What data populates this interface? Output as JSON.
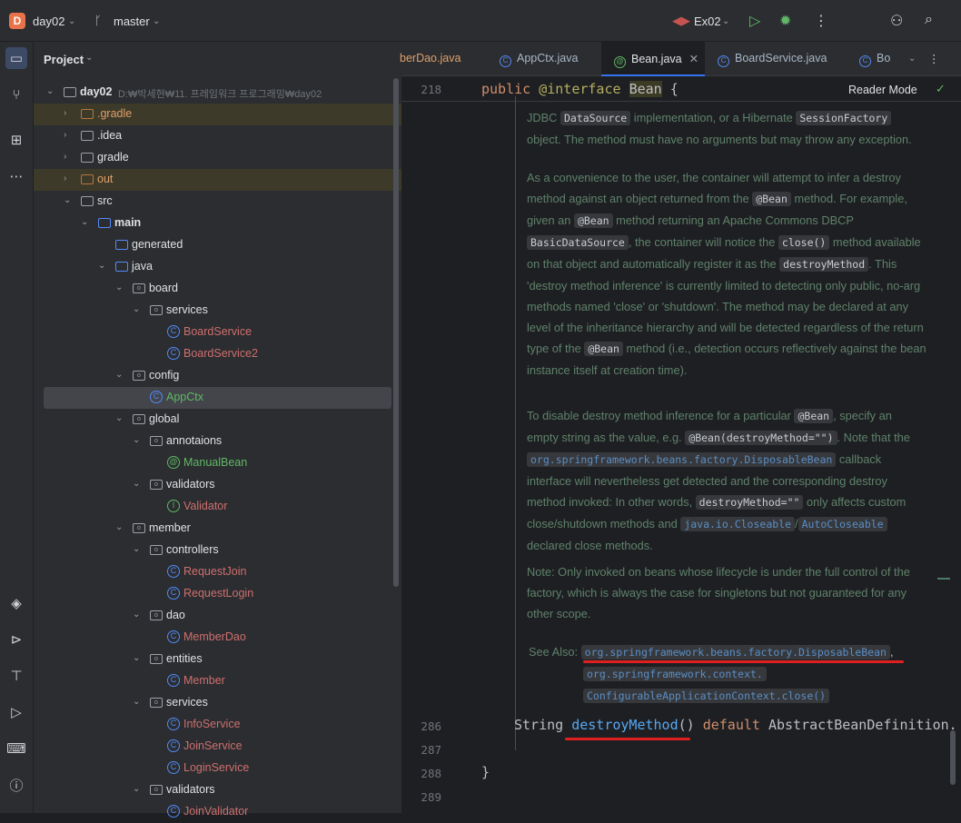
{
  "topbar": {
    "project_badge": "D",
    "project_name": "day02",
    "branch": "master",
    "run_config": "Ex02"
  },
  "project_panel": {
    "title": "Project",
    "root_name": "day02",
    "root_path": "D:₩박세현₩11. 프레임워크 프로그래밍₩day02",
    "items": [
      {
        "label": "src"
      },
      {
        "label": ".gradle"
      },
      {
        "label": ".idea"
      },
      {
        "label": "gradle"
      },
      {
        "label": "out"
      },
      {
        "label": "main"
      },
      {
        "label": "generated"
      },
      {
        "label": "java"
      },
      {
        "label": "board"
      },
      {
        "label": "services"
      },
      {
        "label": "BoardService"
      },
      {
        "label": "BoardService2"
      },
      {
        "label": "config"
      },
      {
        "label": "AppCtx"
      },
      {
        "label": "global"
      },
      {
        "label": "annotaions"
      },
      {
        "label": "ManualBean"
      },
      {
        "label": "validators"
      },
      {
        "label": "Validator"
      },
      {
        "label": "member"
      },
      {
        "label": "controllers"
      },
      {
        "label": "RequestJoin"
      },
      {
        "label": "RequestLogin"
      },
      {
        "label": "dao"
      },
      {
        "label": "MemberDao"
      },
      {
        "label": "entities"
      },
      {
        "label": "Member"
      },
      {
        "label": "services"
      },
      {
        "label": "InfoService"
      },
      {
        "label": "JoinService"
      },
      {
        "label": "LoginService"
      },
      {
        "label": "validators"
      },
      {
        "label": "JoinValidator"
      }
    ]
  },
  "tabs": [
    {
      "label": "berDao.java"
    },
    {
      "label": "AppCtx.java"
    },
    {
      "label": "Bean.java"
    },
    {
      "label": "BoardService.java"
    },
    {
      "label": "Bo"
    }
  ],
  "editor": {
    "reader_mode": "Reader Mode",
    "line_218": "218",
    "line_286": "286",
    "line_287": "287",
    "line_288": "288",
    "line_289": "289",
    "code_218_kw": "public",
    "code_218_ann": "@interface",
    "code_218_name": "Bean",
    "code_218_brace": " {",
    "code_286_type": "String ",
    "code_286_method": "destroyMethod",
    "code_286_parens": "() ",
    "code_286_kw": "default",
    "code_286_rest": " AbstractBeanDefinition.",
    "code_288": "}",
    "doc": {
      "p1_a": "JDBC ",
      "p1_code1": "DataSource",
      "p1_b": " implementation, or a Hibernate ",
      "p1_code2": "SessionFactory",
      "p1_c": "object. The method must have no arguments but may throw any exception.",
      "p2_a": "As a convenience to the user, the container will attempt to infer a destroy method against an object returned from the ",
      "p2_code1": "@Bean",
      "p2_b": " method. For example, given an ",
      "p2_code2": "@Bean",
      "p2_c": " method returning an Apache Commons DBCP ",
      "p2_code3": "BasicDataSource",
      "p2_d": ", the container will notice the ",
      "p2_code4": "close()",
      "p2_e": " method available on that object and automatically register it as the ",
      "p2_code5": "destroyMethod",
      "p2_f": ". This 'destroy method inference' is currently limited to detecting only public, no-arg methods named 'close' or 'shutdown'. The method may be declared at any level of the inheritance hierarchy and will be detected regardless of the return type of the ",
      "p2_code6": "@Bean",
      "p2_g": " method (i.e., detection occurs reflectively against the bean instance itself at creation time).",
      "p3_a": "To disable destroy method inference for a particular ",
      "p3_code1": "@Bean",
      "p3_b": ", specify an empty string as the value, e.g. ",
      "p3_code2": "@Bean(destroyMethod=\"\")",
      "p3_c": ". Note that the ",
      "p3_link1": "org.springframework.beans.factory.DisposableBean",
      "p3_d": " callback interface will nevertheless get detected and the corresponding destroy method invoked: In other words, ",
      "p3_code3": "destroyMethod=\"\"",
      "p3_e": " only affects custom close/shutdown methods and ",
      "p3_link2": "java.io.Closeable",
      "p3_slash": "/",
      "p3_link3": "AutoCloseable",
      "p3_f": " declared close methods.",
      "p4": "Note: Only invoked on beans whose lifecycle is under the full control of the factory, which is always the case for singletons but not guaranteed for any other scope.",
      "see_also": "See Also:",
      "see_link1": "org.springframework.beans.factory.DisposableBean",
      "see_comma": ",",
      "see_link2": "org.springframework.context.",
      "see_link3": "ConfigurableApplicationContext.close()"
    }
  },
  "colors": {
    "accent": "#3574f0",
    "annotation_underline": "#e02020"
  }
}
